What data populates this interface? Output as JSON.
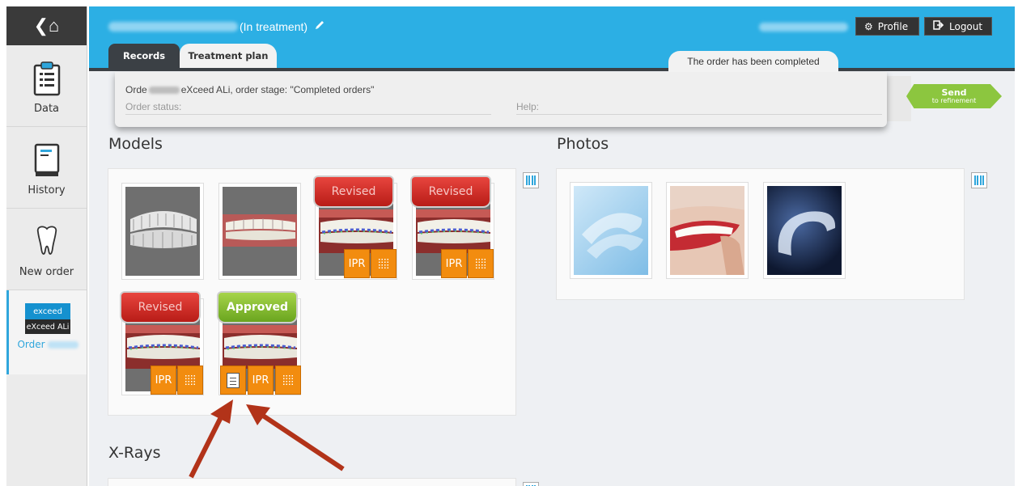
{
  "sidebar": {
    "items": [
      {
        "label": "Data"
      },
      {
        "label": "History"
      },
      {
        "label": "New order"
      }
    ],
    "order": {
      "logo_top": "exceed",
      "logo_bottom": "eXceed ALi",
      "label": "Order"
    }
  },
  "header": {
    "patient_status": "(In treatment)",
    "profile_label": "Profile",
    "logout_label": "Logout",
    "tabs": [
      {
        "label": "Records",
        "active": true
      },
      {
        "label": "Treatment plan",
        "active": false
      }
    ],
    "completed_banner": "The order has been completed"
  },
  "order_panel": {
    "prefix": "Orde",
    "description": "eXceed ALi, order stage: \"Completed orders\"",
    "status_label": "Order status:",
    "help_label": "Help:",
    "send_label": "Send",
    "send_sublabel": "to refinement"
  },
  "sections": {
    "models_title": "Models",
    "photos_title": "Photos",
    "xrays_title": "X-Rays"
  },
  "models": [
    {
      "type": "scan"
    },
    {
      "type": "photo"
    },
    {
      "badge": "Revised",
      "buttons": [
        "IPR",
        "grid"
      ]
    },
    {
      "badge": "Revised",
      "buttons": [
        "IPR",
        "grid"
      ]
    },
    {
      "badge": "Revised",
      "buttons": [
        "IPR",
        "grid"
      ]
    },
    {
      "badge": "Approved",
      "buttons": [
        "document",
        "IPR",
        "grid"
      ]
    }
  ],
  "ipr_label": "IPR",
  "colors": {
    "header": "#2cafe4",
    "revised": "#d2302a",
    "approved": "#8cc63f",
    "action_button": "#f28c0f",
    "annotation_arrow": "#b23319"
  }
}
